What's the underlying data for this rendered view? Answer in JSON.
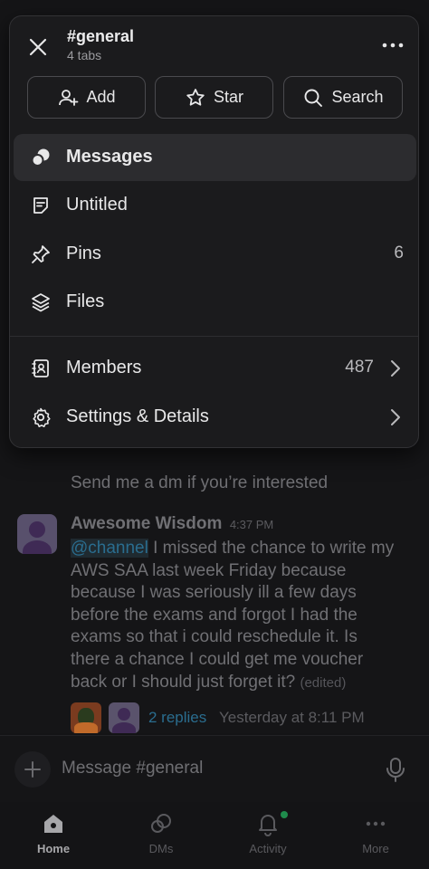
{
  "channel": {
    "title": "#general",
    "subtitle": "4 tabs"
  },
  "actions": {
    "add_label": "Add",
    "star_label": "Star",
    "search_label": "Search"
  },
  "menu": {
    "messages_label": "Messages",
    "untitled_label": "Untitled",
    "pins_label": "Pins",
    "pins_count": "6",
    "files_label": "Files",
    "members_label": "Members",
    "members_count": "487",
    "settings_label": "Settings & Details"
  },
  "chat": {
    "prev_line": "Send me a dm if you’re interested",
    "author": "Awesome Wisdom",
    "time": "4:37 PM",
    "mention": "@channel",
    "body": " I missed the chance to write my AWS SAA last week Friday because because I was seriously ill a few days before the exams and forgot I had the exams so that i could reschedule it. Is there a chance I could get me voucher back or I should just forget it? ",
    "edited": "(edited)",
    "replies": "2 replies",
    "reply_time": "Yesterday at 8:11 PM"
  },
  "composer": {
    "placeholder": "Message #general"
  },
  "nav": {
    "home": "Home",
    "dms": "DMs",
    "activity": "Activity",
    "more": "More"
  },
  "colors": {
    "accent_link": "#2a6d8f",
    "activity_dot": "#1f8b4c"
  }
}
